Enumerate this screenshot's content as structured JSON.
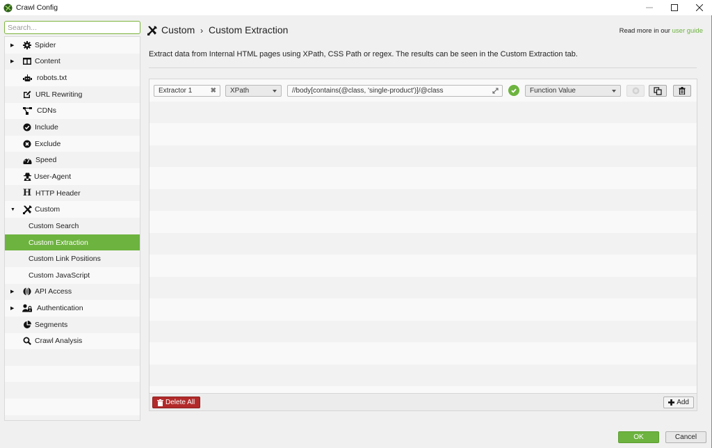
{
  "window": {
    "title": "Crawl Config",
    "controls": [
      "minimize",
      "maximize",
      "close"
    ]
  },
  "sidebar": {
    "search_placeholder": "Search...",
    "search_value": "",
    "items": [
      {
        "label": "Spider",
        "icon": "gear-icon",
        "expandable": true,
        "expanded": false
      },
      {
        "label": "Content",
        "icon": "columns-icon",
        "expandable": true,
        "expanded": false
      },
      {
        "label": "robots.txt",
        "icon": "robot-icon",
        "expandable": false
      },
      {
        "label": "URL Rewriting",
        "icon": "edit-icon",
        "expandable": false
      },
      {
        "label": "CDNs",
        "icon": "network-icon",
        "expandable": false
      },
      {
        "label": "Include",
        "icon": "check-circle-icon",
        "expandable": false
      },
      {
        "label": "Exclude",
        "icon": "x-circle-icon",
        "expandable": false
      },
      {
        "label": "Speed",
        "icon": "speedometer-icon",
        "expandable": false
      },
      {
        "label": "User-Agent",
        "icon": "user-secret-icon",
        "expandable": false
      },
      {
        "label": "HTTP Header",
        "icon": "heading-icon",
        "expandable": false
      },
      {
        "label": "Custom",
        "icon": "tools-icon",
        "expandable": true,
        "expanded": true
      },
      {
        "label": "Custom Search",
        "child": true
      },
      {
        "label": "Custom Extraction",
        "child": true,
        "selected": true
      },
      {
        "label": "Custom Link Positions",
        "child": true
      },
      {
        "label": "Custom JavaScript",
        "child": true
      },
      {
        "label": "API Access",
        "icon": "globe-icon",
        "expandable": true,
        "expanded": false
      },
      {
        "label": "Authentication",
        "icon": "user-lock-icon",
        "expandable": true,
        "expanded": false
      },
      {
        "label": "Segments",
        "icon": "pie-chart-icon",
        "expandable": false
      },
      {
        "label": "Crawl Analysis",
        "icon": "search-icon",
        "expandable": false
      }
    ]
  },
  "header": {
    "breadcrumb_parent": "Custom",
    "breadcrumb_sep": "›",
    "breadcrumb_current": "Custom Extraction",
    "readmore_prefix": "Read more in our ",
    "readmore_link": "user guide",
    "description": "Extract data from Internal HTML pages using XPath, CSS Path or regex. The results can be seen in the Custom Extraction tab."
  },
  "extractors": [
    {
      "name": "Extractor 1",
      "type": "XPath",
      "expression": "//body[contains(@class, 'single-product')]/@class",
      "valid": true,
      "extract_mode": "Function Value"
    }
  ],
  "panel": {
    "delete_all_label": "Delete All",
    "add_label": "Add"
  },
  "footer": {
    "ok_label": "OK",
    "cancel_label": "Cancel"
  },
  "colors": {
    "accent": "#6db33f",
    "danger": "#b22a2a"
  }
}
